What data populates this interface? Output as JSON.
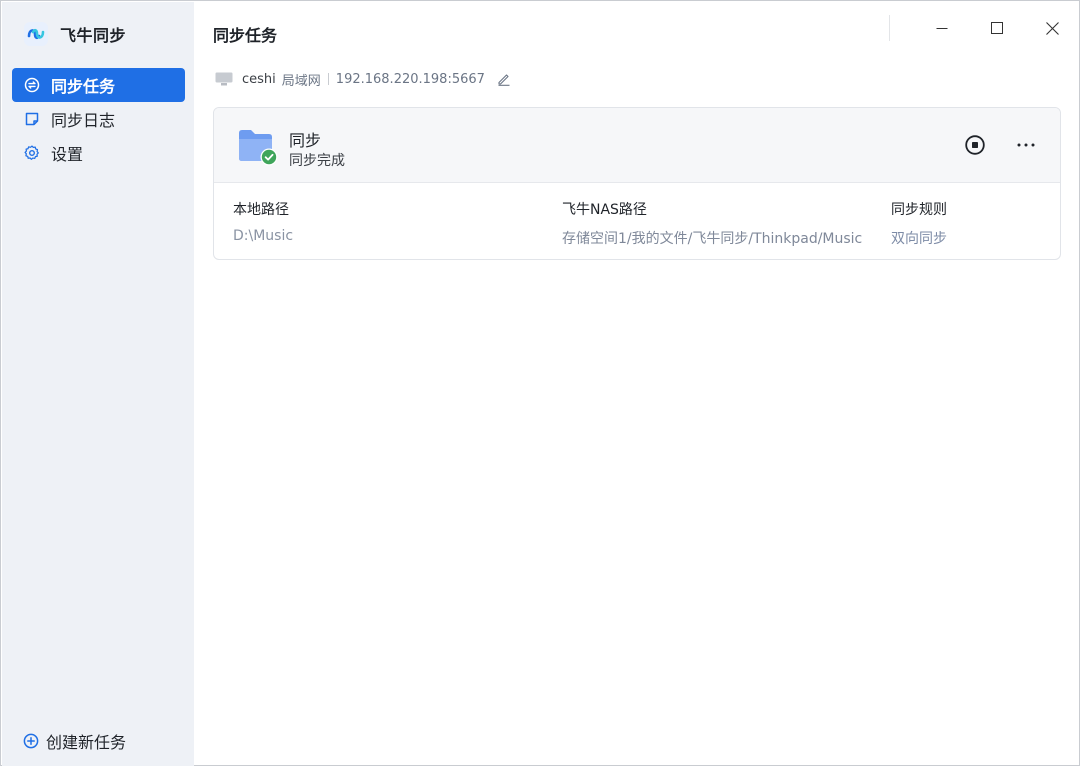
{
  "app": {
    "name": "飞牛同步"
  },
  "sidebar": {
    "items": [
      {
        "label": "同步任务",
        "icon": "sync-icon",
        "active": true
      },
      {
        "label": "同步日志",
        "icon": "log-icon",
        "active": false
      },
      {
        "label": "设置",
        "icon": "gear-icon",
        "active": false
      }
    ],
    "create_label": "创建新任务"
  },
  "header": {
    "title": "同步任务"
  },
  "connection": {
    "name": "ceshi",
    "type": "局域网",
    "address": "192.168.220.198:5667"
  },
  "task": {
    "name": "同步",
    "status": "同步完成",
    "columns": [
      {
        "header": "本地路径",
        "value": "D:\\Music"
      },
      {
        "header": "飞牛NAS路径",
        "value": "存储空间1/我的文件/飞牛同步/Thinkpad/Music"
      },
      {
        "header": "同步规则",
        "value": "双向同步"
      }
    ]
  },
  "colors": {
    "accent": "#1f6fe5",
    "sidebar_bg": "#eef1f6",
    "success": "#3fa55b",
    "folder": "#6e9cf0"
  }
}
